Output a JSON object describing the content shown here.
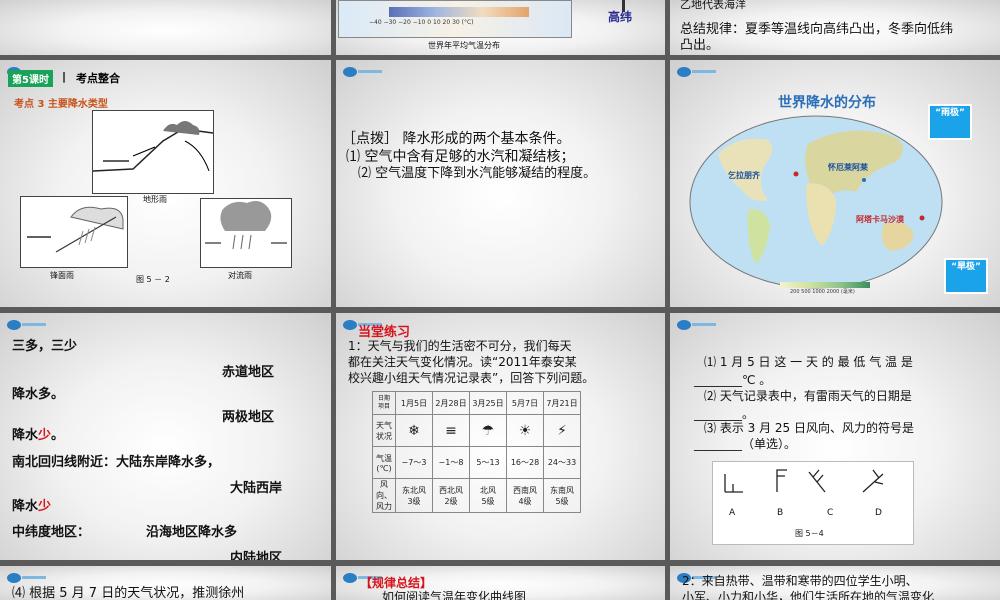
{
  "r1": {
    "s2": {
      "map_scale": "−40  −30  −20  −10   0   10   20   30 (°C)",
      "caption": "世界年平均气温分布",
      "overlay_label": "高纬"
    },
    "s3": {
      "line1": "乙地代表海洋",
      "line2": "总结规律：夏季等温线向高纬凸出，冬季向低纬",
      "line3": "凸出。"
    }
  },
  "r2": {
    "s1": {
      "header_tag": "第5课时",
      "header_sep": "|",
      "header_title": "考点整合",
      "topic": "考点 3    主要降水类型",
      "cap_orographic": "地形雨",
      "cap_frontal": "锋面雨",
      "cap_convective": "对流雨",
      "figure_no": "图 5 － 2"
    },
    "s2": {
      "title": "［点拨］   降水形成的两个基本条件。",
      "line1": "⑴ 空气中含有足够的水汽和凝结核；",
      "line2": "⑵ 空气温度下降到水汽能够凝结的程度。"
    },
    "s3": {
      "title": "世界降水的分布",
      "wet_label": "“雨极”",
      "dry_label": "“旱极”",
      "place1": "乞拉朋齐",
      "place2": "怀厄莱阿莱",
      "place3": "阿塔卡马沙漠",
      "legend": "200  500  1000  2000 (毫米)"
    }
  },
  "r3": {
    "s1": {
      "l1": "三多，三少",
      "l2": "赤道地区",
      "l3": "降水多。",
      "l4": "两极地区",
      "l5a": "降水",
      "l5b": "少",
      "l5c": "。",
      "l6": "南北回归线附近：大陆东岸降水多，",
      "l7": "大陆西岸",
      "l8a": "降水",
      "l8b": "少",
      "l9a": "中纬度地区：",
      "l9b": "沿海地区降水多",
      "l10": "内陆地区"
    },
    "s2": {
      "header": "当堂练习",
      "q1": "1：天气与我们的生活密不可分，我们每天",
      "q2": "都在关注天气变化情况。读“2011年泰安某",
      "q3": "校兴趣小组天气情况记录表”，回答下列问题。",
      "table": {
        "corner_top": "日期",
        "corner_bottom": "项目",
        "dates": [
          "1月5日",
          "2月28日",
          "3月25日",
          "5月7日",
          "7月21日"
        ],
        "row_weather": "天气状况",
        "weather_icons": [
          "❄",
          "≡",
          "☂",
          "☀",
          "⚡"
        ],
        "row_temp": "气温(℃)",
        "temps": [
          "−7～3",
          "−1～8",
          "5～13",
          "16～28",
          "24～33"
        ],
        "row_wind": "风向、风力",
        "winds": [
          [
            "东北风",
            "3级"
          ],
          [
            "西北风",
            "2级"
          ],
          [
            "北风",
            "5级"
          ],
          [
            "西南风",
            "4级"
          ],
          [
            "东南风",
            "5级"
          ]
        ]
      }
    },
    "s3": {
      "q1a": "⑴ 1 月 5 日 这 一 天 的 最 低 气 温 是",
      "q1b": "________℃ 。",
      "q2a": "⑵ 天气记录表中，有雷雨天气的日期是",
      "q2b": "________。",
      "q3a": "⑶ 表示 3 月 25 日风向、风力的符号是",
      "q3b": "________（单选）。",
      "options": [
        "A",
        "B",
        "C",
        "D"
      ],
      "figure_no": "图 5－4"
    }
  },
  "r4": {
    "s1": {
      "text": "⑷ 根据 5 月 7 日的天气状况，推测徐州"
    },
    "s2": {
      "header": "【规律总结】",
      "text": "如何阅读气温年变化曲线图"
    },
    "s3": {
      "line1": "2：来自热带、温带和寒带的四位学生小明、",
      "line2": "小军、小力和小华，他们生活所在地的气温变化"
    }
  }
}
